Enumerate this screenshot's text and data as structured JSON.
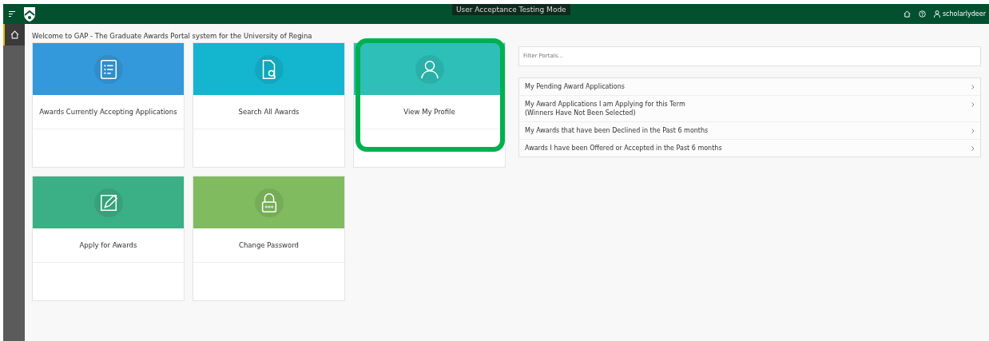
{
  "header": {
    "mode_badge": "User Acceptance Testing Mode",
    "username": "scholarlydeer"
  },
  "sidebar": {
    "items": [
      {
        "selected": true
      }
    ]
  },
  "welcome": "Welcome to GAP - The Graduate Awards Portal system for the University of Regina",
  "tiles": [
    {
      "title": "Awards Currently Accepting Applications",
      "color": "#3399db",
      "highlighted": false
    },
    {
      "title": "Search All Awards",
      "color": "#14b6cf",
      "highlighted": false
    },
    {
      "title": "View My Profile",
      "color": "#2ebfb8",
      "highlighted": true
    },
    {
      "title": "Apply for Awards",
      "color": "#3baf85",
      "highlighted": false
    },
    {
      "title": "Change Password",
      "color": "#80bb5f",
      "highlighted": false
    }
  ],
  "filter": {
    "placeholder": "Filter Portals..."
  },
  "portals": [
    {
      "lines": [
        "My Pending Award Applications"
      ]
    },
    {
      "lines": [
        "My Award Applications I am Applying for this Term",
        "(Winners Have Not Been Selected)"
      ]
    },
    {
      "lines": [
        "My Awards that have been Declined in the Past 6 months"
      ]
    },
    {
      "lines": [
        "Awards I have been Offered or Accepted in the Past 6 months"
      ]
    }
  ]
}
